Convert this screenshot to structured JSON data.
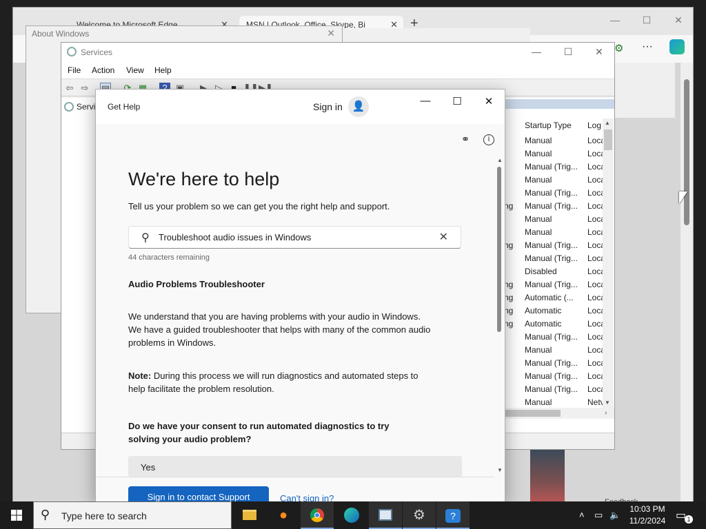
{
  "edge": {
    "tabs": [
      {
        "label": "Welcome to Microsoft Edge"
      },
      {
        "label": "MSN | Outlook, Office, Skype, Bi"
      }
    ],
    "new_tab_glyph": "+",
    "controls": {
      "minimize": "—",
      "maximize": "☐",
      "close": "✕"
    },
    "toolbar_more": "···",
    "feedback_label": "Feedback"
  },
  "about_window": {
    "title": "About Windows",
    "close": "✕"
  },
  "services": {
    "title": "Services",
    "controls": {
      "minimize": "—",
      "maximize": "☐",
      "close": "✕"
    },
    "menu": [
      "File",
      "Action",
      "View",
      "Help"
    ],
    "toolbar_icons": [
      "back-icon",
      "forward-icon",
      "console-icon",
      "refresh-icon",
      "export-icon",
      "help-icon",
      "properties-icon",
      "start-icon",
      "start-alt-icon",
      "stop-icon",
      "pause-icon",
      "restart-icon"
    ],
    "tree_label": "Servi",
    "columns": {
      "startup_type": "Startup Type",
      "log_on": "Log"
    },
    "rows": [
      {
        "frag": "",
        "startup": "Manual",
        "logon": "Loca"
      },
      {
        "frag": "",
        "startup": "Manual",
        "logon": "Loca"
      },
      {
        "frag": "",
        "startup": "Manual (Trig...",
        "logon": "Loca"
      },
      {
        "frag": "",
        "startup": "Manual",
        "logon": "Loca"
      },
      {
        "frag": "",
        "startup": "Manual (Trig...",
        "logon": "Loca"
      },
      {
        "frag": "ng",
        "startup": "Manual (Trig...",
        "logon": "Loca"
      },
      {
        "frag": "",
        "startup": "Manual",
        "logon": "Loca"
      },
      {
        "frag": "",
        "startup": "Manual",
        "logon": "Loca"
      },
      {
        "frag": "ng",
        "startup": "Manual (Trig...",
        "logon": "Loca"
      },
      {
        "frag": "",
        "startup": "Manual (Trig...",
        "logon": "Loca"
      },
      {
        "frag": "",
        "startup": "Disabled",
        "logon": "Loca"
      },
      {
        "frag": "ng",
        "startup": "Manual (Trig...",
        "logon": "Loca"
      },
      {
        "frag": "ng",
        "startup": "Automatic (...",
        "logon": "Loca"
      },
      {
        "frag": "ng",
        "startup": "Automatic",
        "logon": "Loca"
      },
      {
        "frag": "ng",
        "startup": "Automatic",
        "logon": "Loca"
      },
      {
        "frag": "",
        "startup": "Manual (Trig...",
        "logon": "Loca"
      },
      {
        "frag": "",
        "startup": "Manual",
        "logon": "Loca"
      },
      {
        "frag": "",
        "startup": "Manual (Trig...",
        "logon": "Loca"
      },
      {
        "frag": "",
        "startup": "Manual (Trig...",
        "logon": "Loca"
      },
      {
        "frag": "",
        "startup": "Manual (Trig...",
        "logon": "Loca"
      },
      {
        "frag": "",
        "startup": "Manual",
        "logon": "Netv"
      }
    ]
  },
  "get_help": {
    "title": "Get Help",
    "sign_in": "Sign in",
    "avatar_glyph": "👤",
    "controls": {
      "minimize": "—",
      "maximize": "☐",
      "close": "✕"
    },
    "heading": "We're here to help",
    "subheading": "Tell us your problem so we can get you the right help and support.",
    "search": {
      "value": "Troubleshoot audio issues in Windows",
      "clear": "✕"
    },
    "chars_remaining": "44 characters remaining",
    "section_title": "Audio Problems Troubleshooter",
    "para1": "We understand that you are having problems with your audio in Windows. We have a guided troubleshooter that helps with many of the common audio problems in Windows.",
    "note_label": "Note:",
    "note_text": " During this process we will run diagnostics and automated steps to help facilitate the problem resolution.",
    "consent_question": "Do we have your consent to run automated diagnostics to try solving your audio problem?",
    "yes_option": "Yes",
    "primary_button": "Sign in to contact Support",
    "cant_sign_in": "Can't sign in?"
  },
  "taskbar": {
    "search_placeholder": "Type here to search",
    "apps": [
      "file-explorer",
      "firefox",
      "chrome",
      "edge",
      "services",
      "settings",
      "get-help"
    ],
    "time": "10:03 PM",
    "date": "11/2/2024",
    "notification_count": "1"
  },
  "colors": {
    "accent": "#1464c0",
    "taskbar": "#1c1c1c",
    "services_header": "#c8d7e8"
  }
}
